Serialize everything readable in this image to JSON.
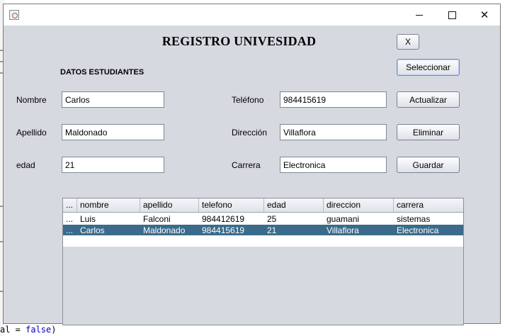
{
  "window": {
    "title": "",
    "controls": {
      "minimize": "minimize",
      "maximize": "maximize",
      "close": "close"
    }
  },
  "form": {
    "heading": "REGISTRO UNIVESIDAD",
    "subheading": "DATOS ESTUDIANTES",
    "x_button": "X",
    "labels": {
      "nombre": "Nombre",
      "apellido": "Apellido",
      "edad": "edad",
      "telefono": "Teléfono",
      "direccion": "Dirección",
      "carrera": "Carrera"
    },
    "values": {
      "nombre": "Carlos",
      "apellido": "Maldonado",
      "edad": "21",
      "telefono": "984415619",
      "direccion": "Villaflora",
      "carrera": "Electronica"
    },
    "buttons": {
      "seleccionar": "Seleccionar",
      "actualizar": "Actualizar",
      "eliminar": "Eliminar",
      "guardar": "Guardar"
    }
  },
  "table": {
    "columns": [
      "...",
      "nombre",
      "apellido",
      "telefono",
      "edad",
      "direccion",
      "carrera"
    ],
    "rows": [
      [
        "...",
        "Luis",
        "Falconi",
        "984412619",
        "25",
        "guamani",
        "sistemas"
      ],
      [
        "...",
        "Carlos",
        "Maldonado",
        "984415619",
        "21",
        "Villaflora",
        "Electronica"
      ]
    ],
    "selected_row": 1
  },
  "background_code": {
    "line_prefix": "al = ",
    "keyword": "false",
    "line_suffix": ")"
  },
  "colors": {
    "content_bg": "#d6d9df",
    "selection": "#3b6b8a",
    "focus_border": "#6c8fc4"
  }
}
